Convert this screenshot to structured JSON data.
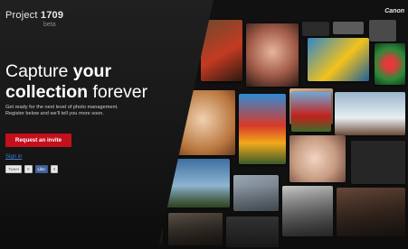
{
  "header": {
    "logo_light": "Project ",
    "logo_bold": "1709",
    "beta": "beta",
    "brand": "Canon"
  },
  "hero": {
    "headline_1a": "Capture ",
    "headline_1b": "your",
    "headline_2a": "collection",
    "headline_2b": " forever",
    "subtext_1": "Get ready for the next level of photo management.",
    "subtext_2": "Register below and we'll tell you more soon.",
    "cta_label": "Request an invite",
    "signin_label": "Sign in"
  },
  "share": {
    "tweet_label": "Tweet",
    "tweet_count": "0",
    "like_label": "Like",
    "like_count": "0"
  },
  "colors": {
    "accent_red": "#c40f1c",
    "link_blue": "#3f7ecf",
    "background": "#111111"
  }
}
